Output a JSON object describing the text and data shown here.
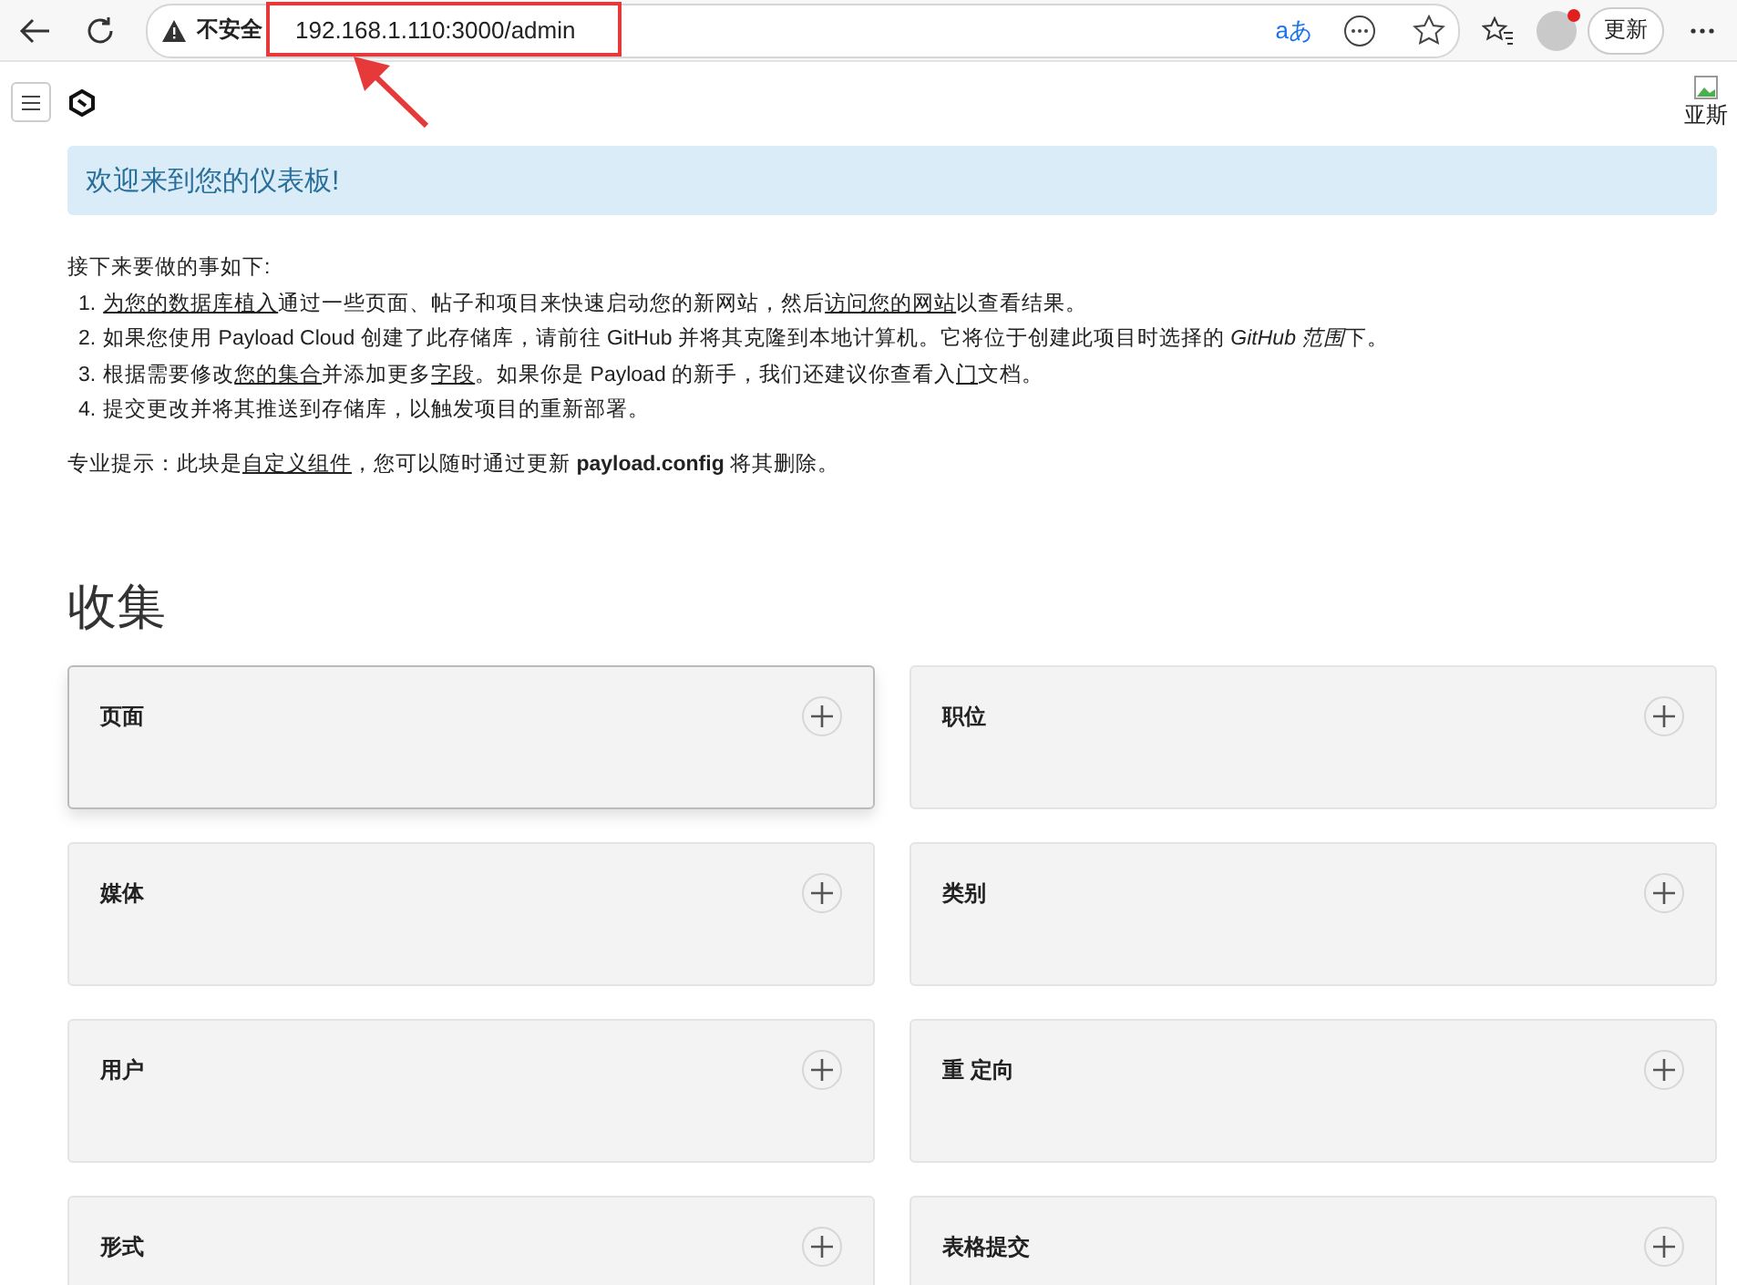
{
  "browser": {
    "security_label": "不安全",
    "url": "192.168.1.110:3000/admin",
    "translate_label": "aあ",
    "update_button": "更新"
  },
  "header": {
    "avatar_alt": "亚斯"
  },
  "banner": {
    "text": "欢迎来到您的仪表板!"
  },
  "intro": {
    "heading": "接下来要做的事如下:",
    "steps": [
      {
        "marker": "1.",
        "parts": [
          {
            "kind": "link",
            "text": "为您的数据库植入"
          },
          {
            "kind": "text",
            "text": "通过一些页面、帖子和项目来快速启动您的新网站，然后"
          },
          {
            "kind": "link",
            "text": "访问您的网站"
          },
          {
            "kind": "text",
            "text": "以查看结果。"
          }
        ]
      },
      {
        "marker": "2.",
        "parts": [
          {
            "kind": "text",
            "text": "如果您使用 Payload Cloud 创建了此存储库，请前往 GitHub 并将其克隆到本地计算机。它将位于创建此项目时选择的 "
          },
          {
            "kind": "italic",
            "text": "GitHub 范围"
          },
          {
            "kind": "text",
            "text": "下。"
          }
        ]
      },
      {
        "marker": "3.",
        "parts": [
          {
            "kind": "text",
            "text": "根据需要修改"
          },
          {
            "kind": "link",
            "text": "您的集合"
          },
          {
            "kind": "text",
            "text": "并添加更多"
          },
          {
            "kind": "link",
            "text": "字段"
          },
          {
            "kind": "text",
            "text": "。如果你是 Payload 的新手，我们还建议你查看入"
          },
          {
            "kind": "link",
            "text": "门"
          },
          {
            "kind": "text",
            "text": "文档。"
          }
        ]
      },
      {
        "marker": "4.",
        "parts": [
          {
            "kind": "text",
            "text": "提交更改并将其推送到存储库，以触发项目的重新部署。"
          }
        ]
      }
    ],
    "tip": [
      {
        "kind": "text",
        "text": "专业提示：此块是"
      },
      {
        "kind": "link",
        "text": "自定义组件"
      },
      {
        "kind": "text",
        "text": "，您可以随时通过更新 "
      },
      {
        "kind": "bold",
        "text": "payload.config"
      },
      {
        "kind": "text",
        "text": " 将其删除。"
      }
    ]
  },
  "collections": {
    "title": "收集",
    "cards": [
      {
        "label": "页面",
        "highlighted": true
      },
      {
        "label": "职位",
        "highlighted": false
      },
      {
        "label": "媒体",
        "highlighted": false
      },
      {
        "label": "类别",
        "highlighted": false
      },
      {
        "label": "用户",
        "highlighted": false
      },
      {
        "label": "重 定向",
        "highlighted": false
      },
      {
        "label": "形式",
        "highlighted": false
      },
      {
        "label": "表格提交",
        "highlighted": false
      }
    ]
  },
  "annotation": {
    "kind": "box-arrow"
  }
}
